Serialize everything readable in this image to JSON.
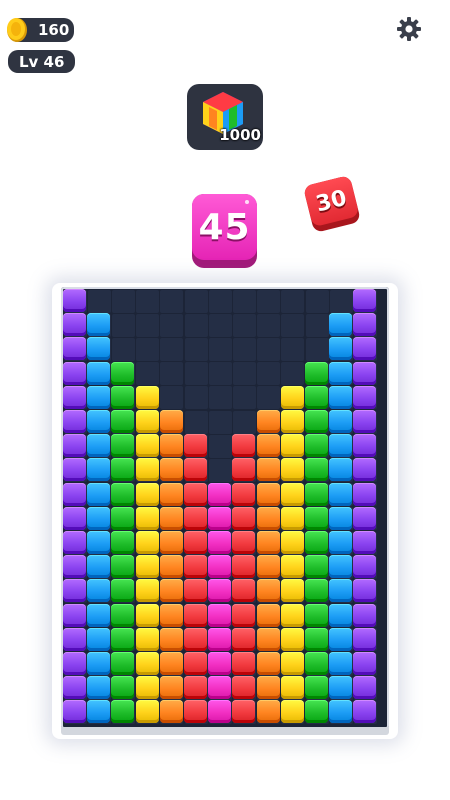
{
  "hud": {
    "coins": "160",
    "level": "Lv 46"
  },
  "icons": {
    "coin": "coin-icon",
    "settings": "gear-icon",
    "goal": "rainbow-cube-icon"
  },
  "goal": {
    "count": "1000"
  },
  "current_block": {
    "value": "45",
    "color": "#ff3fd0"
  },
  "next_block": {
    "value": "30",
    "color": "#ff3b44"
  },
  "board": {
    "columns": 13,
    "rows": 18,
    "column_colors": [
      "purple",
      "blue",
      "green",
      "yellow",
      "orange",
      "red",
      "pink",
      "red",
      "orange",
      "yellow",
      "green",
      "blue",
      "purple"
    ],
    "column_heights": [
      18,
      17,
      15,
      14,
      13,
      12,
      10,
      12,
      13,
      14,
      15,
      17,
      18
    ],
    "palette": {
      "purple": "#8a43f0",
      "blue": "#1c9cf5",
      "green": "#1fbd2a",
      "yellow": "#ffd21a",
      "orange": "#ff8420",
      "red": "#f23a3f",
      "pink": "#f22fc2"
    }
  }
}
